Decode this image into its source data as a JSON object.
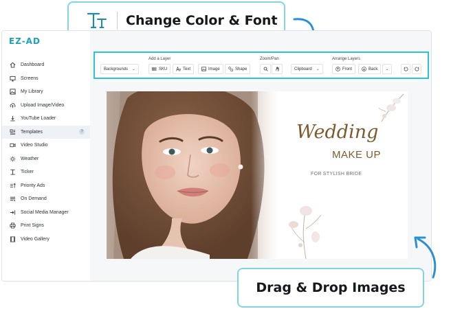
{
  "callouts": {
    "top": "Change Color & Font",
    "bottom": "Drag & Drop Images"
  },
  "app": {
    "logo": "EZ-AD"
  },
  "sidebar": {
    "items": [
      {
        "label": "Dashboard",
        "icon": "home-icon"
      },
      {
        "label": "Screens",
        "icon": "monitor-icon"
      },
      {
        "label": "My Library",
        "icon": "image-icon"
      },
      {
        "label": "Upload Image/Video",
        "icon": "cloud-upload-icon"
      },
      {
        "label": "YouTube Loader",
        "icon": "download-icon"
      },
      {
        "label": "Templates",
        "icon": "template-icon",
        "active": true,
        "badge": "?"
      },
      {
        "label": "Video Studio",
        "icon": "video-icon"
      },
      {
        "label": "Weather",
        "icon": "sun-icon"
      },
      {
        "label": "Ticker",
        "icon": "text-icon"
      },
      {
        "label": "Priority Ads",
        "icon": "priority-icon"
      },
      {
        "label": "On Demand",
        "icon": "list-icon"
      },
      {
        "label": "Social Media Manager",
        "icon": "share-icon"
      },
      {
        "label": "Print Signs",
        "icon": "printer-icon"
      },
      {
        "label": "Video Gallery",
        "icon": "film-icon"
      }
    ]
  },
  "toolbar": {
    "groups": {
      "add_layer": "Add a Layer",
      "zoom_pan": "Zoom/Pan",
      "arrange": "Arrange Layers"
    },
    "backgrounds": "Backgrounds",
    "sku": "SKU",
    "text": "Text",
    "image": "Image",
    "shape": "Shape",
    "clipboard": "Clipboard",
    "front": "Front",
    "back": "Back"
  },
  "design": {
    "title": "Wedding",
    "subtitle": "MAKE UP",
    "tagline": "FOR STYLISH BRIDE"
  },
  "colors": {
    "accent": "#2cc3d6",
    "callout_border": "#7fd6e2",
    "arrow": "#2b8fd1",
    "design_gold": "#7b5a2e"
  }
}
